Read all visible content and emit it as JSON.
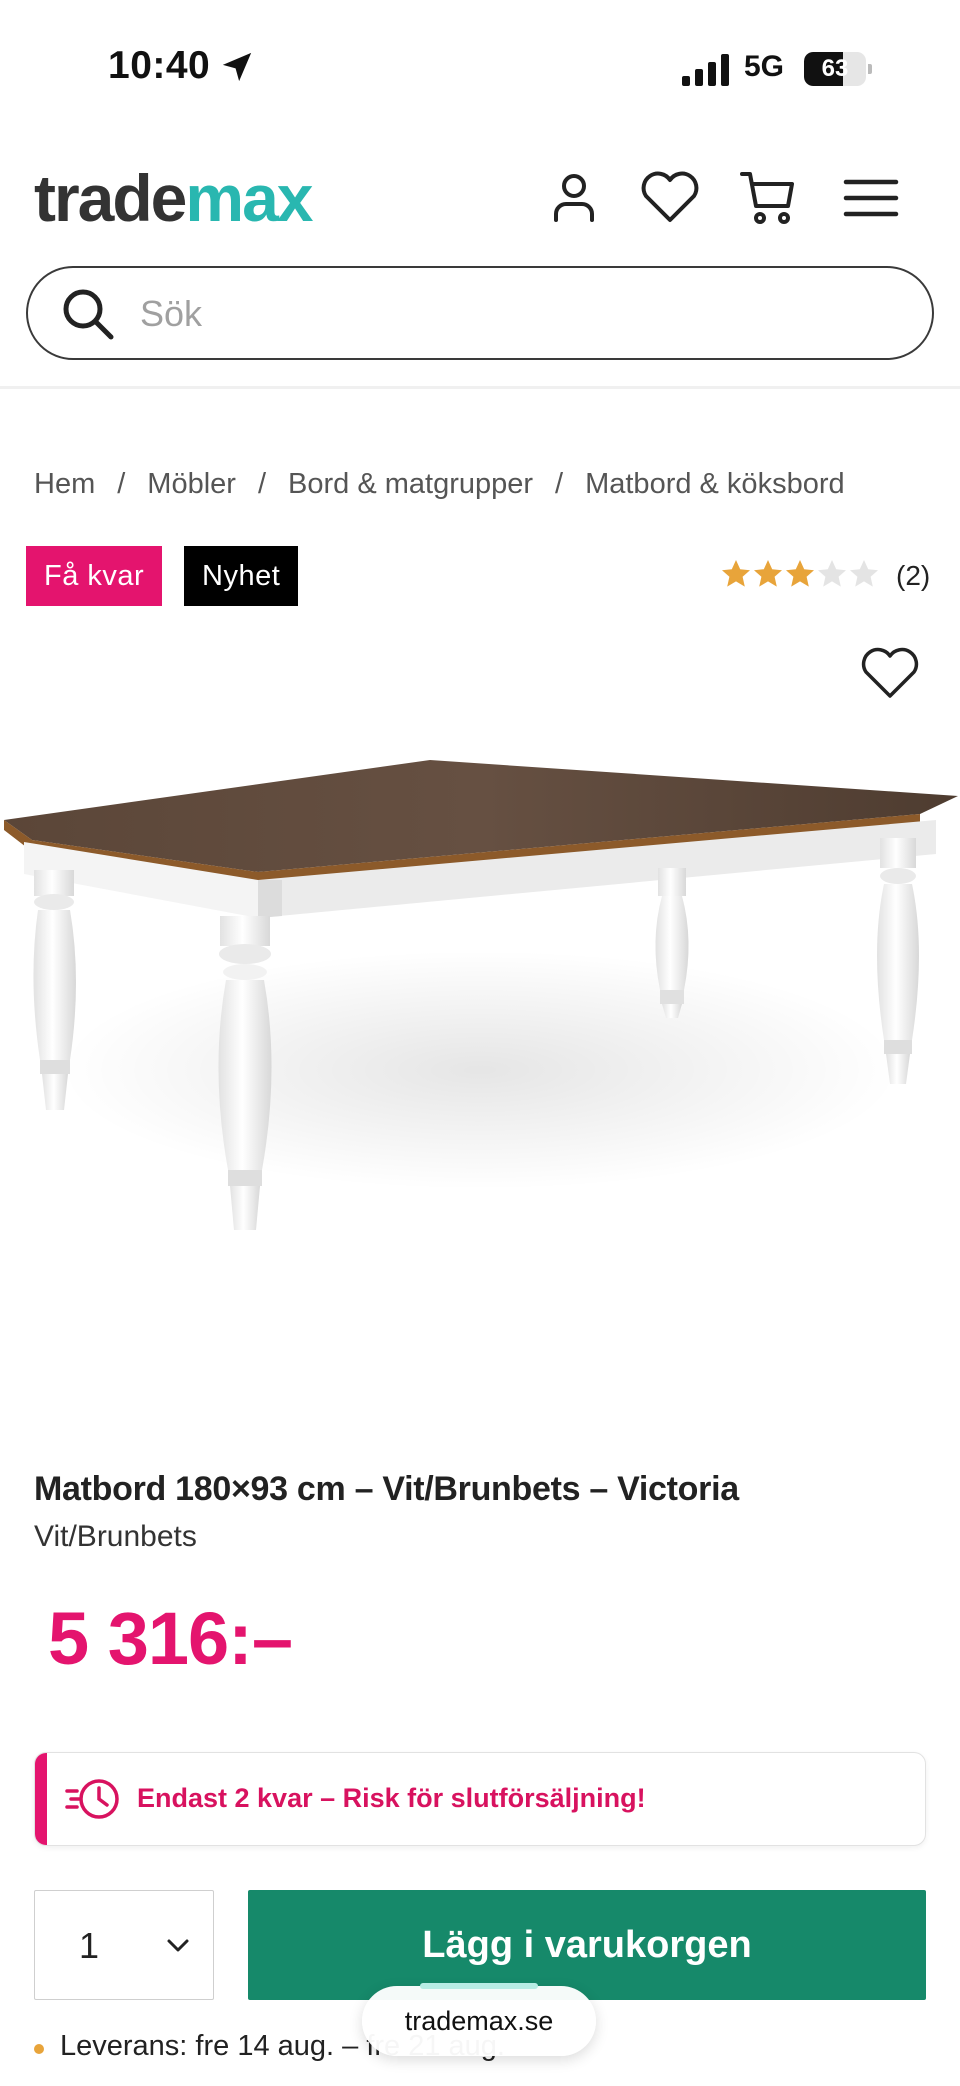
{
  "status_bar": {
    "time": "10:40",
    "network": "5G",
    "battery": "63",
    "battery_fraction": 0.63
  },
  "header": {
    "logo_part1": "trade",
    "logo_part2": "max",
    "search_placeholder": "Sök"
  },
  "icons": {
    "account": "user-icon",
    "wishlist": "heart-icon",
    "cart": "cart-icon",
    "menu": "hamburger-menu-icon",
    "search": "search-icon"
  },
  "breadcrumb": {
    "items": [
      "Hem",
      "Möbler",
      "Bord & matgrupper",
      "Matbord & köksbord"
    ],
    "separator": "/"
  },
  "badges": {
    "few_left": "Få kvar",
    "new": "Nyhet"
  },
  "rating": {
    "stars": 3,
    "max": 5,
    "count": "(2)"
  },
  "product": {
    "title": "Matbord 180×93 cm – Vit/Brunbets – Victoria",
    "variant": "Vit/Brunbets",
    "price": "5 316:–"
  },
  "stock_alert": {
    "text": "Endast 2 kvar – Risk för slutförsäljning!"
  },
  "purchase": {
    "quantity": "1",
    "add_to_cart_label": "Lägg i varukorgen"
  },
  "delivery": {
    "text": "Leverans: fre 14 aug. – fre 21 aug."
  },
  "browser": {
    "url": "trademax.se"
  },
  "colors": {
    "accent_pink": "#e4146e",
    "brand_teal": "#29b7b0",
    "cart_green": "#16896a",
    "star_gold": "#e8a43a"
  }
}
